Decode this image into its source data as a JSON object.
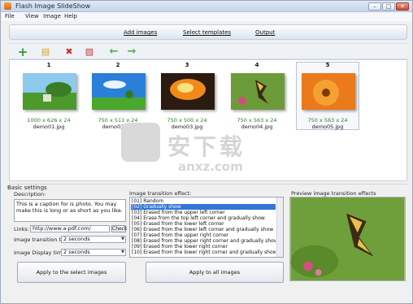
{
  "window": {
    "title": "Flash Image SlideShow",
    "min_label": "–",
    "max_label": "□",
    "close_label": "✕"
  },
  "menu": [
    "File",
    "View",
    "Image",
    "Help"
  ],
  "nav": {
    "add_images": "Add images",
    "select_templates": "Select templates",
    "output": "Output"
  },
  "toolbar": {
    "add_icon": "+",
    "folder_icon": "▤",
    "delete_icon": "✖",
    "clear_icon": "▧",
    "left_icon": "←",
    "right_icon": "→"
  },
  "thumbnails": [
    {
      "num": "1",
      "size": "1000 x 626 x 24",
      "file": "demo01.jpg"
    },
    {
      "num": "2",
      "size": "750 x 511 x 24",
      "file": "demo02.jpg"
    },
    {
      "num": "3",
      "size": "750 x 500 x 24",
      "file": "demo03.jpg"
    },
    {
      "num": "4",
      "size": "750 x 563 x 24",
      "file": "demo04.jpg"
    },
    {
      "num": "5",
      "size": "750 x 563 x 24",
      "file": "demo05.jpg"
    }
  ],
  "selected_thumbnail": "5",
  "watermark": {
    "text": "安下载",
    "sub": "anxz.com"
  },
  "basic_settings": {
    "title": "Basic settings",
    "description_label": "Description:",
    "description_value": "This is a caption for is photo. You may make this is long or as short as you like.",
    "links_label": "Links:",
    "links_value": "http://www.a-pdf.com/",
    "check_label": "Check",
    "transition_time_label": "Image transition time:",
    "transition_time_value": "2 seconds",
    "display_time_label": "Image Display time:",
    "display_time_value": "2 seconds",
    "effect_label": "Image transition effect:",
    "effects": [
      "[01] Random",
      "[02] Gradually show",
      "[03] Erased from the upper left corner",
      "[04] Erase from the top left corner and gradually show",
      "[05] Erased from the lower left corner",
      "[06] Erased from the lower left corner and gradually show",
      "[07] Erased from the upper right corner",
      "[08] Erased from the upper right corner and gradually show",
      "[09] Erased from the lower right corner",
      "[10] Erased from the lower right corner and gradually show"
    ],
    "selected_effect": "[02] Gradually show",
    "preview_label": "Preview image transition effects",
    "apply_selected": "Apply to the select images",
    "apply_all": "Apply to all images"
  },
  "colors": {
    "selection": "#3375d6",
    "size_text": "#2c7a2c"
  }
}
